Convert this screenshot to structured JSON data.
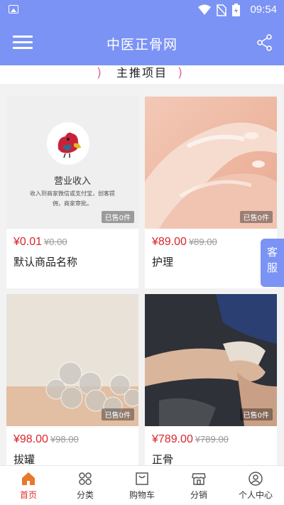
{
  "status_bar": {
    "time": "09:54"
  },
  "app_bar": {
    "title": "中医正骨网"
  },
  "section": {
    "title": "主推项目"
  },
  "products": [
    {
      "name": "默认商品名称",
      "price": "¥0.01",
      "old_price": "¥0.00",
      "sold": "已售0件",
      "placeholder": {
        "title": "营业收入",
        "desc": "收入到商家微信或支付宝，创客提佣，商家审批。"
      }
    },
    {
      "name": "护理",
      "price": "¥89.00",
      "old_price": "¥89.00",
      "sold": "已售0件"
    },
    {
      "name": "拔罐",
      "price": "¥98.00",
      "old_price": "¥98.00",
      "sold": "已售0件"
    },
    {
      "name": "正骨",
      "price": "¥789.00",
      "old_price": "¥789.00",
      "sold": "已售0件"
    }
  ],
  "kefu": {
    "line1": "客",
    "line2": "服"
  },
  "tabbar": {
    "items": [
      {
        "label": "首页",
        "icon": "home-icon",
        "active": true
      },
      {
        "label": "分类",
        "icon": "category-icon"
      },
      {
        "label": "购物车",
        "icon": "cart-icon"
      },
      {
        "label": "分销",
        "icon": "store-icon"
      },
      {
        "label": "个人中心",
        "icon": "user-icon"
      }
    ]
  },
  "colors": {
    "primary": "#7b93f4",
    "price": "#d9262b",
    "active_tab": "#e2312d",
    "accent_deco": "#e36ba1"
  }
}
